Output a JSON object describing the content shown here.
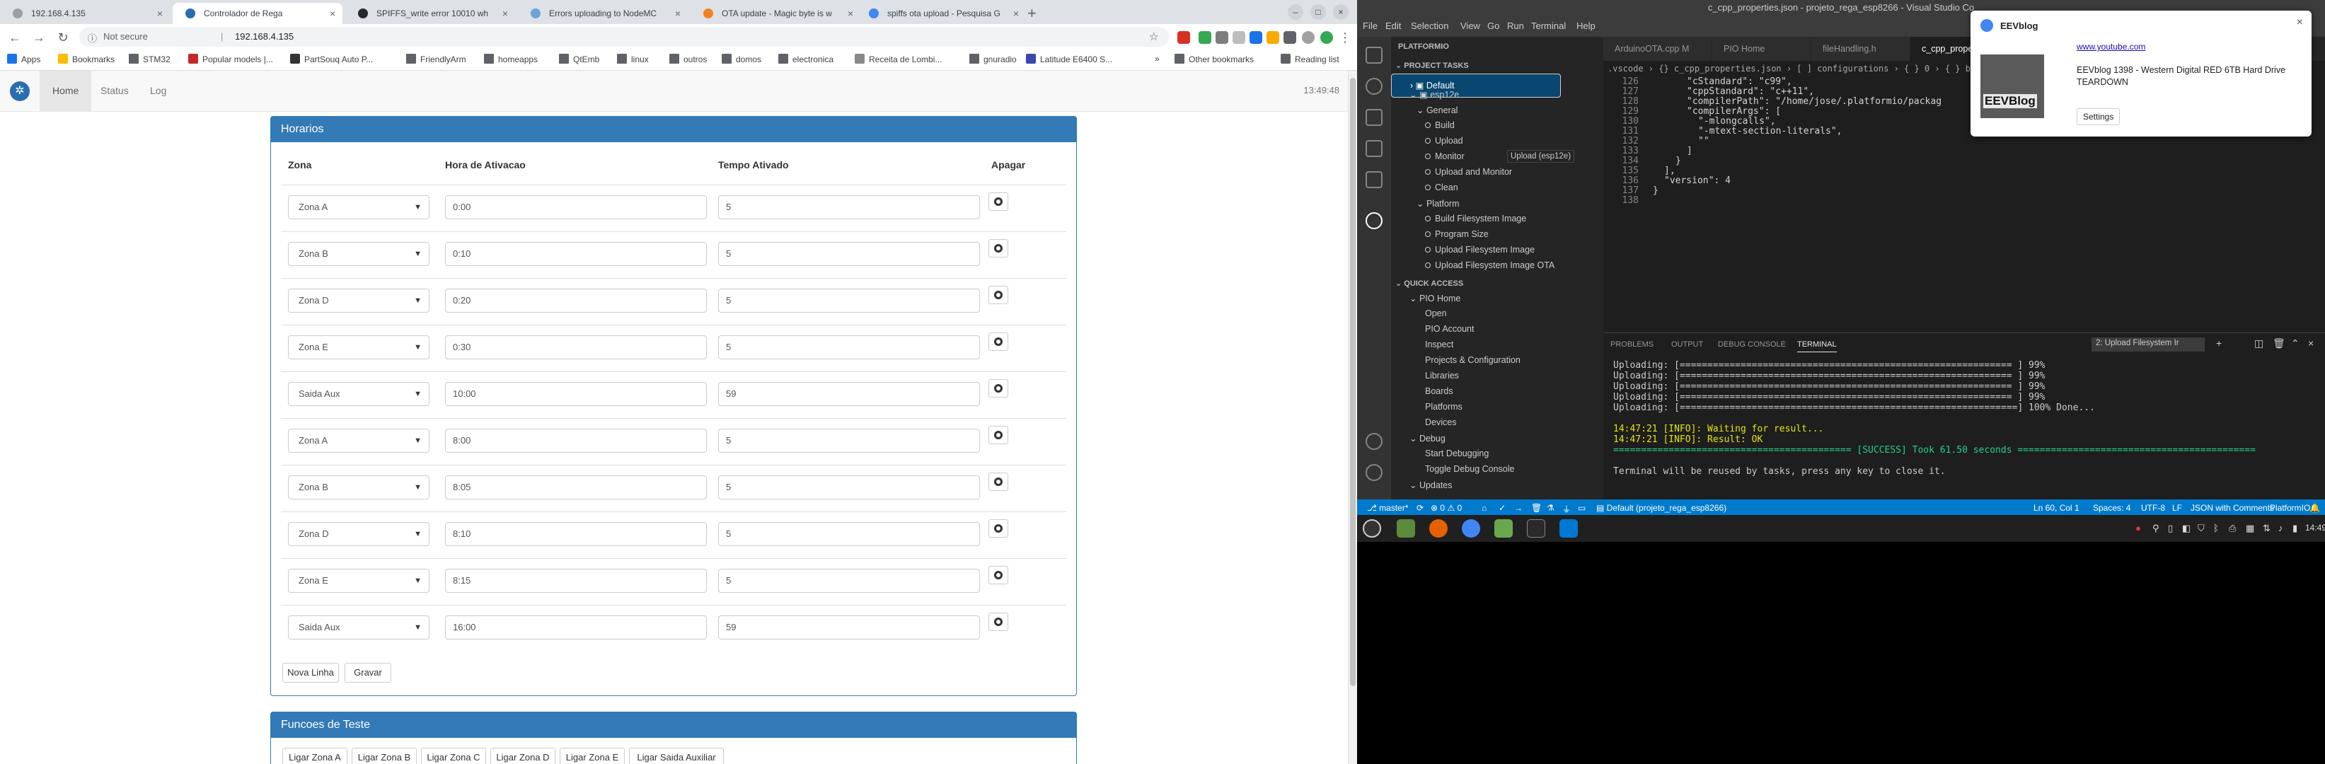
{
  "browser": {
    "tabs": [
      {
        "label": "192.168.4.135",
        "active": false
      },
      {
        "label": "Controlador de Rega",
        "active": true
      },
      {
        "label": "SPIFFS_write error 10010 wh",
        "active": false
      },
      {
        "label": "Errors uploading to NodeMC",
        "active": false
      },
      {
        "label": "OTA update - Magic byte is w",
        "active": false
      },
      {
        "label": "spiffs ota upload - Pesquisa G",
        "active": false
      }
    ],
    "omnibox": {
      "security": "Not secure",
      "url": "192.168.4.135"
    },
    "bookmarks": [
      "Apps",
      "Bookmarks",
      "STM32",
      "Popular models |...",
      "PartSouq Auto P...",
      "FriendlyArm",
      "homeapps",
      "QtEmb",
      "linux",
      "outros",
      "domos",
      "electronica",
      "Receita de Lombi...",
      "gnuradio",
      "Latitude E6400 S..."
    ],
    "bookmarks_more": "»",
    "other_bookmarks": "Other bookmarks",
    "reading_list": "Reading list"
  },
  "app": {
    "nav": [
      "Home",
      "Status",
      "Log"
    ],
    "active_nav": "Home",
    "clock": "13:49:48",
    "horarios": {
      "title": "Horarios",
      "columns": [
        "Zona",
        "Hora de Ativacao",
        "Tempo Ativado",
        "Apagar"
      ],
      "rows": [
        {
          "zona": "Zona A",
          "hora": "0:00",
          "tempo": "5"
        },
        {
          "zona": "Zona B",
          "hora": "0:10",
          "tempo": "5"
        },
        {
          "zona": "Zona D",
          "hora": "0:20",
          "tempo": "5"
        },
        {
          "zona": "Zona E",
          "hora": "0:30",
          "tempo": "5"
        },
        {
          "zona": "Saida Aux",
          "hora": "10:00",
          "tempo": "59"
        },
        {
          "zona": "Zona A",
          "hora": "8:00",
          "tempo": "5"
        },
        {
          "zona": "Zona B",
          "hora": "8:05",
          "tempo": "5"
        },
        {
          "zona": "Zona D",
          "hora": "8:10",
          "tempo": "5"
        },
        {
          "zona": "Zona E",
          "hora": "8:15",
          "tempo": "5"
        },
        {
          "zona": "Saida Aux",
          "hora": "16:00",
          "tempo": "59"
        }
      ],
      "btn_new": "Nova Linha",
      "btn_save": "Gravar"
    },
    "testes": {
      "title": "Funcoes de Teste",
      "buttons": [
        "Ligar Zona A",
        "Ligar Zona B",
        "Ligar Zona C",
        "Ligar Zona D",
        "Ligar Zona E",
        "Ligar Saida Auxiliar"
      ]
    }
  },
  "vscode": {
    "title": "c_cpp_properties.json - projeto_rega_esp8266 - Visual Studio Co",
    "menu": [
      "File",
      "Edit",
      "Selection",
      "View",
      "Go",
      "Run",
      "Terminal",
      "Help"
    ],
    "sidebar_title": "PLATFORMIO",
    "project_tasks": "PROJECT TASKS",
    "tasks": [
      "Default",
      "esp12e",
      "General",
      "Build",
      "Upload",
      "Monitor",
      "Upload and Monitor",
      "Clean",
      "Platform",
      "Build Filesystem Image",
      "Program Size",
      "Upload Filesystem Image",
      "Upload Filesystem Image OTA"
    ],
    "tooltip": "Upload (esp12e)",
    "quick_access": "QUICK ACCESS",
    "quick": [
      "PIO Home",
      "Open",
      "PIO Account",
      "Inspect",
      "Projects & Configuration",
      "Libraries",
      "Boards",
      "Platforms",
      "Devices",
      "Debug",
      "Start Debugging",
      "Toggle Debug Console",
      "Updates"
    ],
    "editor_tabs": [
      "ArduinoOTA.cpp M",
      "PIO Home",
      "fileHandling.h",
      "c_cpp_properties.json"
    ],
    "breadcrumb": ".vscode  ›  {} c_cpp_properties.json  ›  [ ] configurations  ›  { } 0  ›  { } browse  ›  [ ] path",
    "lines": [
      {
        "n": "126",
        "t": "\"cStandard\": \"c99\","
      },
      {
        "n": "127",
        "t": "\"cppStandard\": \"c++11\","
      },
      {
        "n": "128",
        "t": "\"compilerPath\": \"/home/jose/.platformio/packag"
      },
      {
        "n": "129",
        "t": "\"compilerArgs\": ["
      },
      {
        "n": "130",
        "t": "\"-mlongcalls\","
      },
      {
        "n": "131",
        "t": "\"-mtext-section-literals\","
      },
      {
        "n": "132",
        "t": "\"\""
      },
      {
        "n": "133",
        "t": "]"
      },
      {
        "n": "134",
        "t": "}"
      },
      {
        "n": "135",
        "t": "],"
      },
      {
        "n": "136",
        "t": "\"version\": 4"
      },
      {
        "n": "137",
        "t": "}"
      },
      {
        "n": "138",
        "t": ""
      }
    ],
    "panel_tabs": [
      "PROBLEMS",
      "OUTPUT",
      "DEBUG CONSOLE",
      "TERMINAL"
    ],
    "terminal_select": "2: Upload Filesystem Ir",
    "terminal": [
      "Uploading: [============================================================ ] 99%",
      "Uploading: [============================================================ ] 99%",
      "Uploading: [============================================================ ] 99%",
      "Uploading: [============================================================ ] 99%",
      "Uploading: [=============================================================] 100% Done...",
      "",
      "14:47:21 [INFO]: Waiting for result...",
      "14:47:21 [INFO]: Result: OK",
      "=========================================== [SUCCESS] Took 61.50 seconds ===========================================",
      "",
      "Terminal will be reused by tasks, press any key to close it."
    ],
    "status": {
      "branch": "master*",
      "errors": "⊗ 0 ⚠ 0",
      "env": "Default (projeto_rega_esp8266)",
      "position": "Ln 60, Col 1",
      "spaces": "Spaces: 4",
      "encoding": "UTF-8",
      "eol": "LF",
      "lang": "JSON with Comments",
      "pio": "PlatformIO"
    }
  },
  "notification": {
    "app": "EEVblog",
    "link": "www.youtube.com",
    "text": "EEVblog 1398 - Western Digital RED 6TB Hard Drive TEARDOWN",
    "settings": "Settings",
    "thumb": "EEVBlog"
  },
  "taskbar": {
    "time": "14:49"
  }
}
